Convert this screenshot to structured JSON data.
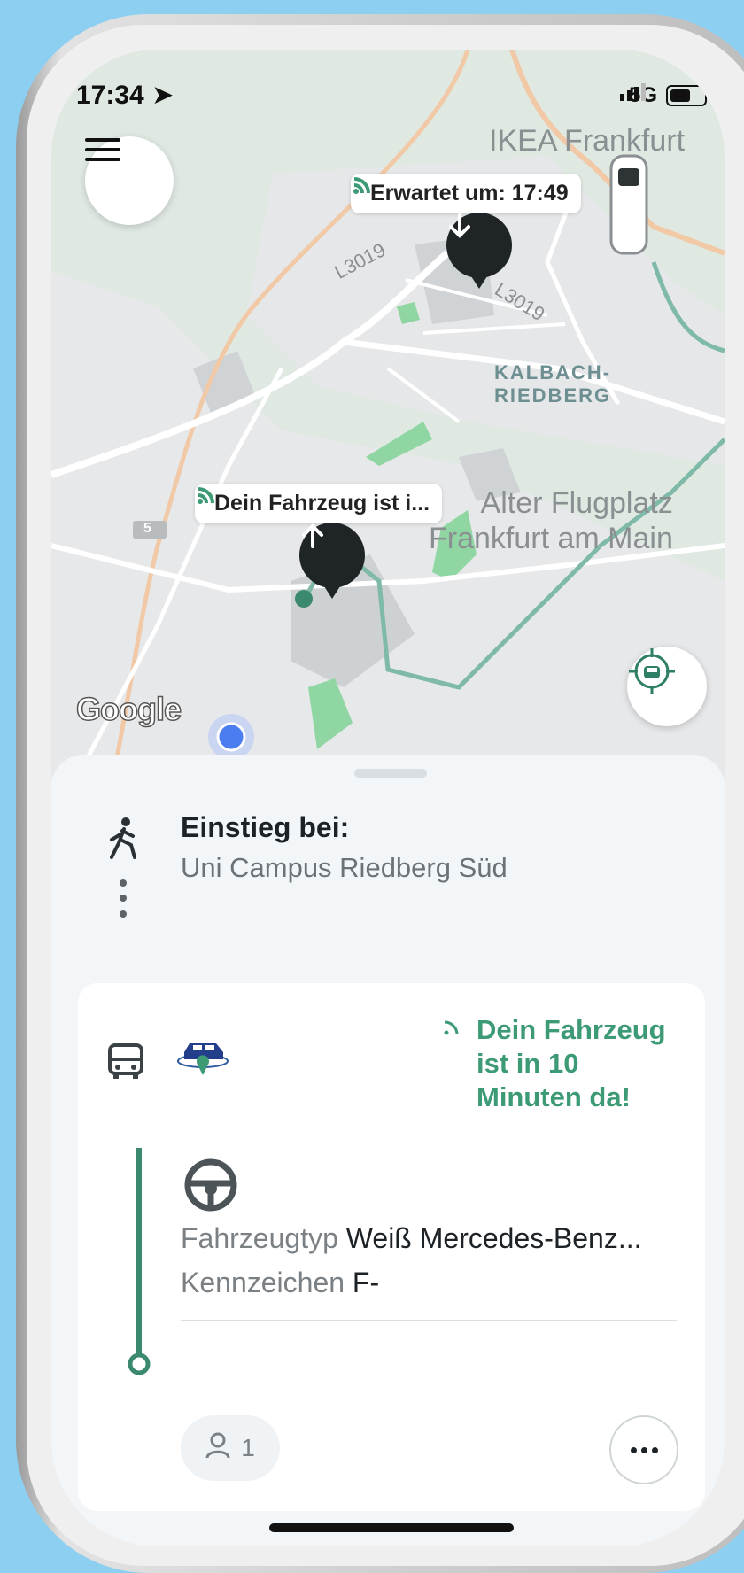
{
  "status_bar": {
    "time": "17:34",
    "network": "5G"
  },
  "map": {
    "eta_bubble": "Erwartet um: 17:49",
    "vehicle_bubble": "Dein Fahrzeug ist i...",
    "labels": {
      "ikea": "IKEA Frankfurt",
      "district": "KALBACH-RIEDBERG",
      "road1": "L3019",
      "road2": "L3019",
      "road3": "5",
      "airfield_line1": "Alter Flugplatz",
      "airfield_line2": "Frankfurt am Main"
    },
    "attribution": "Google"
  },
  "sheet": {
    "boarding_title": "Einstieg bei:",
    "boarding_stop": "Uni Campus Riedberg Süd",
    "vehicle": {
      "arrival_message": "Dein Fahrzeug ist in 10 Minuten da!",
      "type_label": "Fahrzeugtyp",
      "type_value": "Weiß Mercedes-Benz...",
      "plate_label": "Kennzeichen",
      "plate_value": "F-"
    },
    "passengers": "1"
  },
  "colors": {
    "accent_green": "#3c9a74",
    "route_line": "#3b8a70",
    "dark_pin": "#1f2426"
  }
}
